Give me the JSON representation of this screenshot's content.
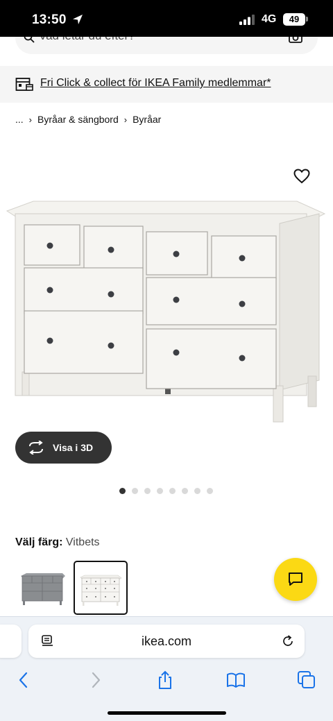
{
  "status_bar": {
    "time": "13:50",
    "network": "4G",
    "battery": "49"
  },
  "search": {
    "placeholder": "Vad letar du efter?"
  },
  "promo": {
    "text": "Fri Click & collect för IKEA Family medlemmar*"
  },
  "breadcrumb": {
    "items": [
      "...",
      "Byråar & sängbord",
      "Byråar"
    ]
  },
  "product": {
    "view_3d_label": "Visa i 3D",
    "carousel_count": 8,
    "carousel_active_index": 0
  },
  "color": {
    "label": "Välj färg:",
    "selected": "Vitbets",
    "swatches": [
      {
        "name": "grey",
        "color": "#8a8d90"
      },
      {
        "name": "white",
        "color": "#f3f2ee"
      }
    ]
  },
  "browser": {
    "url": "ikea.com"
  },
  "colors": {
    "accent_yellow": "#fbd914",
    "button_dark": "#333333"
  }
}
